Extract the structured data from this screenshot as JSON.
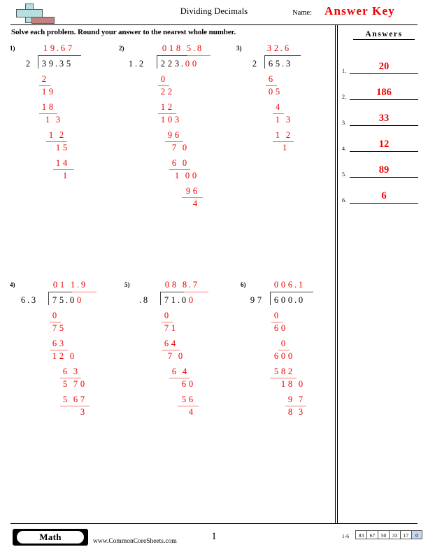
{
  "header": {
    "title": "Dividing Decimals",
    "name_label": "Name:",
    "answer_key_stamp": "Answer Key",
    "logo_icon": "plus-minus-icon",
    "instructions": "Solve each problem. Round your answer to the nearest whole number."
  },
  "answers_panel": {
    "heading": "Answers",
    "rows": [
      {
        "number": "1.",
        "value": "20"
      },
      {
        "number": "2.",
        "value": "186"
      },
      {
        "number": "3.",
        "value": "33"
      },
      {
        "number": "4.",
        "value": "12"
      },
      {
        "number": "5.",
        "value": "89"
      },
      {
        "number": "6.",
        "value": "6"
      }
    ]
  },
  "problems": [
    {
      "number": "1)",
      "divisor": "2",
      "dividend": "39.35",
      "quotient": "19.67",
      "answer": "20",
      "steps": [
        "2",
        "19",
        "18",
        "1 3",
        "1 2",
        "15",
        "14",
        "1"
      ]
    },
    {
      "number": "2)",
      "divisor": "1.2",
      "dividend": "223.00",
      "quotient": "018 5.8",
      "answer": "186",
      "steps": [
        "0",
        "22",
        "12",
        "103",
        "96",
        "7 0",
        "6 0",
        "1 00",
        "96",
        "4"
      ]
    },
    {
      "number": "3)",
      "divisor": "2",
      "dividend": "65.3",
      "quotient": "32.6",
      "answer": "33",
      "steps": [
        "6",
        "05",
        "4",
        "1 3",
        "1 2",
        "1"
      ]
    },
    {
      "number": "4)",
      "divisor": "6.3",
      "dividend": "75.00",
      "quotient": "01 1.9",
      "answer": "12",
      "steps": [
        "0",
        "75",
        "63",
        "12 0",
        "6 3",
        "5 70",
        "5 67",
        "3"
      ]
    },
    {
      "number": "5)",
      "divisor": ".8",
      "dividend": "71.00",
      "quotient": "08 8.7",
      "answer": "89",
      "steps": [
        "0",
        "71",
        "64",
        "7 0",
        "6 4",
        "60",
        "56",
        "4"
      ]
    },
    {
      "number": "6)",
      "divisor": "97",
      "dividend": "600.0",
      "quotient": "006.1",
      "answer": "6",
      "steps": [
        "0",
        "60",
        "0",
        "600",
        "582",
        "18 0",
        "9 7",
        "8 3"
      ]
    }
  ],
  "footer": {
    "subject_badge": "Math",
    "site_url": "www.CommonCoreSheets.com",
    "page_number": "1",
    "score_range": "1-6",
    "score_scale": [
      "83",
      "67",
      "50",
      "33",
      "17",
      "0"
    ]
  },
  "colors": {
    "answer_red": "#ee0000",
    "work_red": "#ee0000",
    "rule_red": "#f4756c",
    "logo_plus": "#b8dfe0",
    "logo_minus": "#c58080",
    "score_highlight": "#c9d6ef"
  }
}
